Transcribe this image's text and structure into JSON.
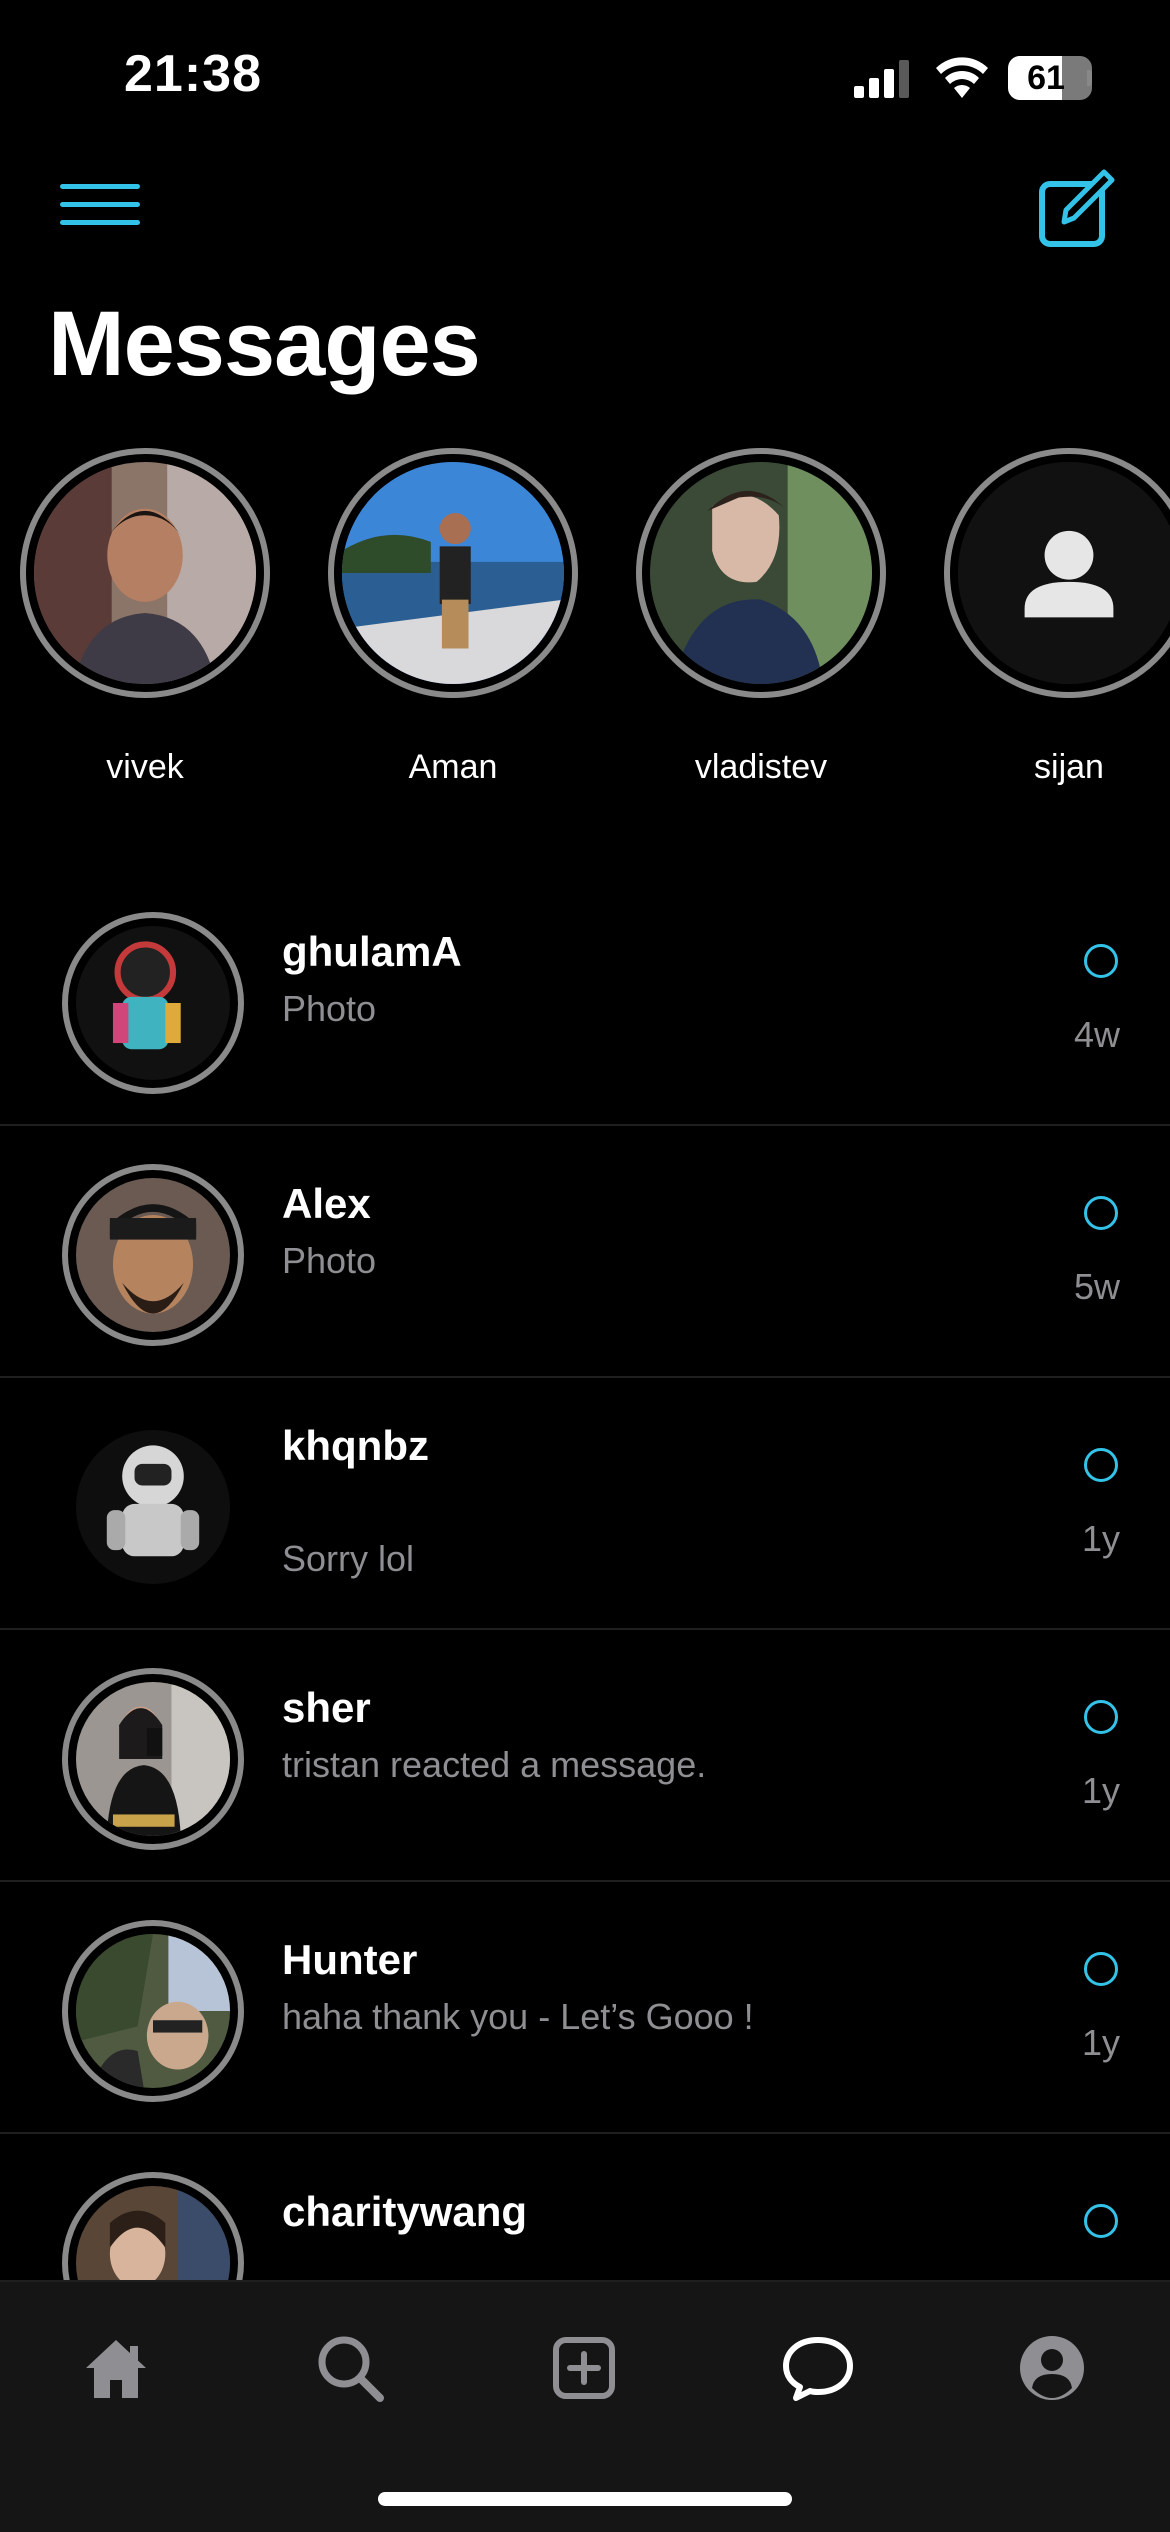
{
  "status_bar": {
    "time": "21:38",
    "battery": "61"
  },
  "header": {
    "title": "Messages",
    "menu_icon": "hamburger-menu-icon",
    "compose_icon": "compose-icon"
  },
  "stories": [
    {
      "name": "vivek"
    },
    {
      "name": "Aman"
    },
    {
      "name": "vladistev"
    },
    {
      "name": "sijan"
    }
  ],
  "conversations": [
    {
      "name": "ghulamA",
      "message": "Photo",
      "time": "4w"
    },
    {
      "name": "Alex",
      "message": "Photo",
      "time": "5w"
    },
    {
      "name": "khqnbz",
      "message": "Sorry lol",
      "time": "1y"
    },
    {
      "name": "sher",
      "message": "tristan reacted a message.",
      "time": "1y"
    },
    {
      "name": "Hunter",
      "message": "haha thank you - Let’s Gooo !",
      "time": "1y"
    },
    {
      "name": "charitywang",
      "message": "",
      "time": ""
    }
  ],
  "tab_bar": {
    "items": [
      "home-icon",
      "search-icon",
      "add-post-icon",
      "messages-icon",
      "profile-icon"
    ]
  },
  "colors": {
    "accent": "#33c2e8",
    "background": "#000000",
    "secondary_text": "#8e8e93",
    "ring": "#8a8a8a"
  }
}
